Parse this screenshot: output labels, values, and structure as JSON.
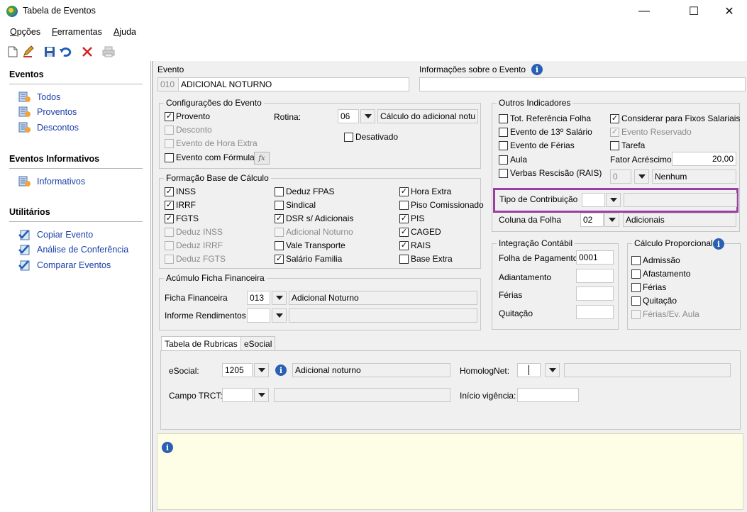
{
  "window": {
    "title": "Tabela de Eventos",
    "minimize": "—",
    "maximize": "☐",
    "close": "✕"
  },
  "menu": {
    "items": [
      {
        "u": "O",
        "rest": "pções"
      },
      {
        "u": "F",
        "rest": "erramentas"
      },
      {
        "u": "A",
        "rest": "juda"
      }
    ]
  },
  "sidebar": {
    "sections": [
      {
        "title": "Eventos",
        "items": [
          "Todos",
          "Proventos",
          "Descontos"
        ]
      },
      {
        "title": "Eventos Informativos",
        "items": [
          "Informativos"
        ]
      },
      {
        "title": "Utilitários",
        "items": [
          "Copiar Evento",
          "Análise de Conferência",
          "Comparar Eventos"
        ]
      }
    ]
  },
  "evento": {
    "label": "Evento",
    "code": "010",
    "name": "ADICIONAL NOTURNO",
    "info_label": "Informações sobre o Evento",
    "info_value": ""
  },
  "config": {
    "title": "Configurações do Evento",
    "provento": "Provento",
    "desconto": "Desconto",
    "hora_extra": "Evento de Hora Extra",
    "formula": "Evento com Fórmula",
    "fx": "fx",
    "rotina_label": "Rotina:",
    "rotina_code": "06",
    "rotina_desc": "Cálculo do adicional notu",
    "desativado": "Desativado",
    "check": "✓"
  },
  "base": {
    "title": "Formação Base de Cálculo",
    "col1": [
      "INSS",
      "IRRF",
      "FGTS",
      "Deduz INSS",
      "Deduz IRRF",
      "Deduz FGTS"
    ],
    "col2": [
      "Deduz FPAS",
      "Sindical",
      "DSR s/ Adicionais",
      "Adicional Noturno",
      "Vale Transporte",
      "Salário Familia"
    ],
    "col3": [
      "Hora Extra",
      "Piso Comissionado",
      "PIS",
      "CAGED",
      "RAIS",
      "Base Extra"
    ]
  },
  "acumulo": {
    "title": "Acúmulo Ficha Financeira",
    "ficha_label": "Ficha Financeira",
    "ficha_code": "013",
    "ficha_desc": "Adicional Noturno",
    "informe_label": "Informe Rendimentos",
    "informe_code": "",
    "informe_desc": ""
  },
  "outros": {
    "title": "Outros Indicadores",
    "left": [
      "Tot. Referência Folha",
      "Evento de 13º Salário",
      "Evento de Férias",
      "Aula",
      "Verbas Rescisão (RAIS)"
    ],
    "right": [
      "Considerar para Fixos Salariais",
      "Evento Reservado",
      "Tarefa"
    ],
    "fator_label": "Fator Acréscimo",
    "fator_value": "20,00",
    "rais_code": "0",
    "rais_desc": "Nenhum",
    "tipo_label": "Tipo de Contribuição",
    "tipo_code": "",
    "tipo_desc": "",
    "coluna_label": "Coluna da Folha",
    "coluna_code": "02",
    "coluna_desc": "Adicionais"
  },
  "integracao": {
    "title": "Integração Contábil",
    "folha_label": "Folha de Pagamento",
    "folha_value": "0001",
    "adiantamento_label": "Adiantamento",
    "ferias_label": "Férias",
    "quitacao_label": "Quitação"
  },
  "proporcional": {
    "title": "Cálculo Proporcional",
    "items": [
      "Admissão",
      "Afastamento",
      "Férias",
      "Quitação",
      "Férias/Ev. Aula"
    ]
  },
  "tabs": {
    "rubricas": "Tabela de Rubricas",
    "esocial": "eSocial"
  },
  "rubricas": {
    "esocial_label": "eSocial:",
    "esocial_code": "1205",
    "esocial_desc": "Adicional noturno",
    "homolog_label": "HomologNet:",
    "homolog_code": "",
    "homolog_desc": "",
    "trct_label": "Campo TRCT:",
    "trct_code": "",
    "trct_desc": "",
    "inicio_label": "Início vigência:",
    "inicio_value": ""
  },
  "info_glyph": "i",
  "colors": {
    "highlight": "#9b3fa3",
    "link": "#1a3fa8",
    "info_panel": "#fefde6"
  }
}
